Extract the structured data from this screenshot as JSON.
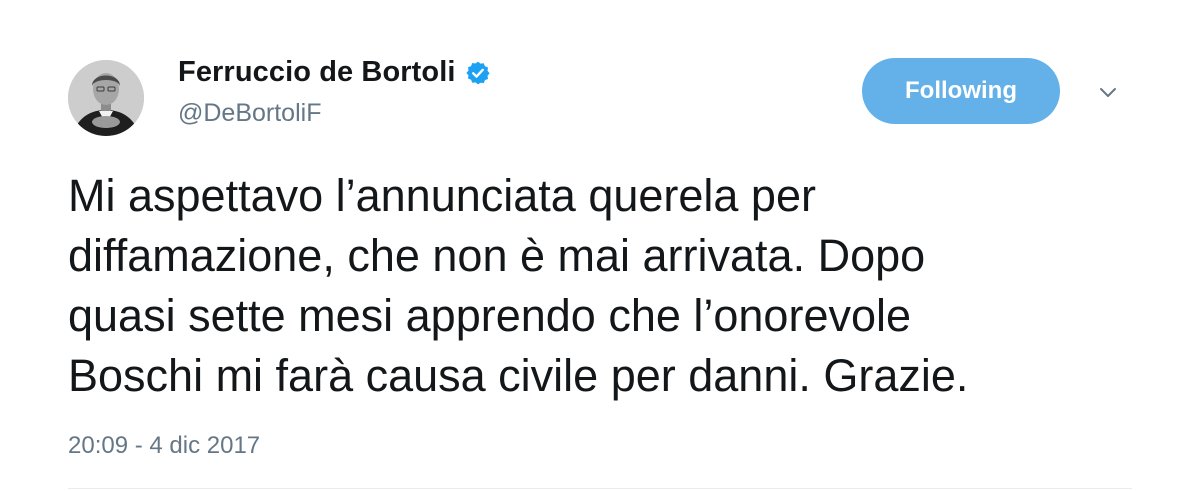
{
  "tweet": {
    "author": {
      "display_name": "Ferruccio de Bortoli",
      "handle": "@DeBortoliF",
      "verified": true,
      "avatar_icon": "profile-photo"
    },
    "follow_button_label": "Following",
    "menu_icon": "chevron-down-icon",
    "text": "Mi aspettavo l’annunciata querela per\ndiffamazione, che non è mai arrivata. Dopo\nquasi sette mesi apprendo che l’onorevole\nBoschi mi farà causa civile per danni. Grazie.",
    "timestamp": "20:09 - 4 dic 2017"
  },
  "colors": {
    "follow_button": "#64b1e9",
    "verified_badge": "#1da1f2",
    "secondary_text": "#657786",
    "primary_text": "#14171a"
  }
}
